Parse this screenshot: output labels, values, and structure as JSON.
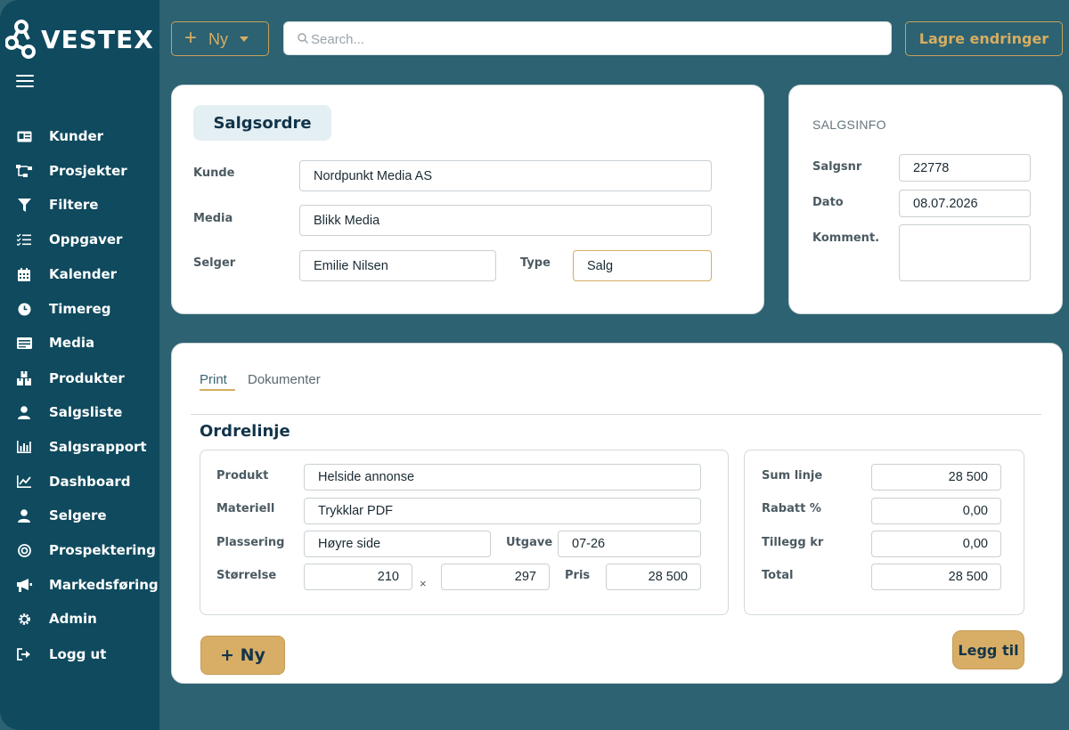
{
  "brand": {
    "name": "VESTEX"
  },
  "sidebar": {
    "items": [
      {
        "label": "Kunder",
        "icon": "id-card-icon"
      },
      {
        "label": "Prosjekter",
        "icon": "hierarchy-icon"
      },
      {
        "label": "Filtere",
        "icon": "filter-icon"
      },
      {
        "label": "Oppgaver",
        "icon": "checklist-icon"
      },
      {
        "label": "Kalender",
        "icon": "calendar-icon"
      },
      {
        "label": "Timereg",
        "icon": "clock-icon"
      },
      {
        "label": "Media",
        "icon": "media-icon"
      },
      {
        "label": "Produkter",
        "icon": "boxes-icon"
      },
      {
        "label": "Salgsliste",
        "icon": "user-icon"
      },
      {
        "label": "Salgsrapport",
        "icon": "bar-chart-icon"
      },
      {
        "label": "Dashboard",
        "icon": "line-chart-icon"
      },
      {
        "label": "Selgere",
        "icon": "user-icon"
      },
      {
        "label": "Prospektering",
        "icon": "target-icon"
      },
      {
        "label": "Markedsføring",
        "icon": "megaphone-icon"
      },
      {
        "label": "Admin",
        "icon": "gear-icon"
      },
      {
        "label": "Logg ut",
        "icon": "logout-icon"
      }
    ]
  },
  "topbar": {
    "new_label": "Ny",
    "search_placeholder": "Search...",
    "save_label": "Lagre endringer"
  },
  "order": {
    "title": "Salgsordre",
    "kunde_label": "Kunde",
    "kunde": "Nordpunkt Media AS",
    "media_label": "Media",
    "media": "Blikk Media",
    "selger_label": "Selger",
    "selger": "Emilie Nilsen",
    "type_label": "Type",
    "type": "Salg"
  },
  "info": {
    "title": "SALGSINFO",
    "salgsnr_label": "Salgsnr",
    "salgsnr": "22778",
    "dato_label": "Dato",
    "dato": "08.07.2026",
    "komment_label": "Komment.",
    "komment": ""
  },
  "tabs": [
    {
      "label": "Print",
      "active": true
    },
    {
      "label": "Dokumenter",
      "active": false
    }
  ],
  "orderline": {
    "title": "Ordrelinje",
    "produkt_label": "Produkt",
    "produkt": "Helside annonse",
    "materiell_label": "Materiell",
    "materiell": "Trykklar PDF",
    "plassering_label": "Plassering",
    "plassering": "Høyre side",
    "utgave_label": "Utgave",
    "utgave": "07-26",
    "storrelse_label": "Størrelse",
    "bredde": "210",
    "times": "×",
    "hoyde": "297",
    "pris_label": "Pris",
    "pris": "28 500",
    "new_line_label": "+ Ny",
    "add_label": "Legg til"
  },
  "summary": {
    "sum_label": "Sum linje",
    "sum": "28 500",
    "rabatt_label": "Rabatt %",
    "rabatt": "0,00",
    "tillegg_label": "Tillegg kr",
    "tillegg": "0,00",
    "total_label": "Total",
    "total": "28 500"
  },
  "colors": {
    "sidebar": "#0f4a5e",
    "background": "#2c6272",
    "accent": "#d6ad62"
  }
}
